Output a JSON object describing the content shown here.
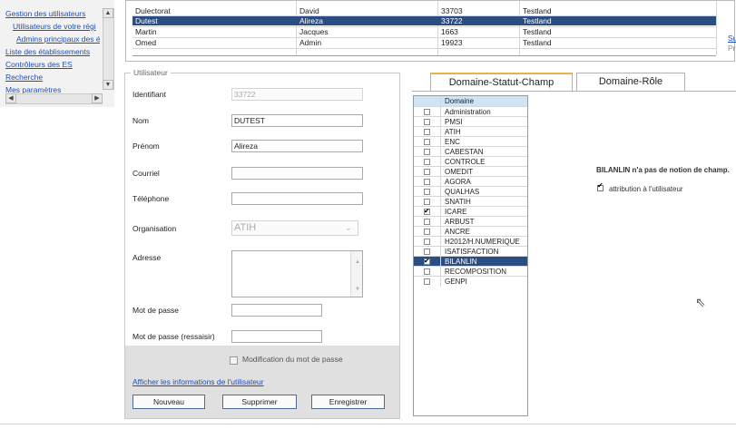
{
  "nav": {
    "items": [
      {
        "label": "Gestion des utilisateurs"
      },
      {
        "label": "Utilisateurs de votre régi"
      },
      {
        "label": "Admins principaux des é"
      },
      {
        "label": "Liste des établissements"
      },
      {
        "label": "Contrôleurs des ES"
      },
      {
        "label": "Recherche"
      },
      {
        "label": "Mes paramètres"
      }
    ]
  },
  "grid": {
    "rows": [
      {
        "nom": "Dulectorat",
        "prenom": "David",
        "id": "33703",
        "org": "Testland",
        "selected": false
      },
      {
        "nom": "Dutest",
        "prenom": "Alireza",
        "id": "33722",
        "org": "Testland",
        "selected": true
      },
      {
        "nom": "Martin",
        "prenom": "Jacques",
        "id": "1663",
        "org": "Testland",
        "selected": false
      },
      {
        "nom": "Omed",
        "prenom": "Admin",
        "id": "19923",
        "org": "Testland",
        "selected": false
      }
    ],
    "pager_next": "Suiva",
    "pager_prev": "Préc"
  },
  "form": {
    "legend": "Utilisateur",
    "identifiant_label": "Identifiant",
    "identifiant_value": "33722",
    "nom_label": "Nom",
    "nom_value": "DUTEST",
    "prenom_label": "Prénom",
    "prenom_value": "Alireza",
    "courriel_label": "Courriel",
    "courriel_value": "",
    "telephone_label": "Téléphone",
    "telephone_value": "",
    "organisation_label": "Organisation",
    "organisation_value": "ATIH",
    "adresse_label": "Adresse",
    "motdepasse_label": "Mot de passe",
    "motdepasse2_label": "Mot de passe (ressaisir)",
    "modif_mdp_label": "Modification du mot de passe",
    "show_info_link": "Afficher les informations de l'utilisateur",
    "btn_nouveau": "Nouveau",
    "btn_supprimer": "Supprimer",
    "btn_enregistrer": "Enregistrer"
  },
  "tabs": [
    {
      "label": "Domaine-Statut-Champ",
      "active": true
    },
    {
      "label": "Domaine-Rôle",
      "active": false
    }
  ],
  "domaine": {
    "header": "Domaine",
    "rows": [
      {
        "label": "Administration",
        "checked": false,
        "selected": false
      },
      {
        "label": "PMSI",
        "checked": false,
        "selected": false
      },
      {
        "label": "ATIH",
        "checked": false,
        "selected": false
      },
      {
        "label": "ENC",
        "checked": false,
        "selected": false
      },
      {
        "label": "CABESTAN",
        "checked": false,
        "selected": false
      },
      {
        "label": "CONTROLE",
        "checked": false,
        "selected": false
      },
      {
        "label": "OMEDIT",
        "checked": false,
        "selected": false
      },
      {
        "label": "AGORA",
        "checked": false,
        "selected": false
      },
      {
        "label": "QUALHAS",
        "checked": false,
        "selected": false
      },
      {
        "label": "SNATIH",
        "checked": false,
        "selected": false
      },
      {
        "label": "ICARE",
        "checked": true,
        "selected": false
      },
      {
        "label": "ARBUST",
        "checked": false,
        "selected": false
      },
      {
        "label": "ANCRE",
        "checked": false,
        "selected": false
      },
      {
        "label": "H2012/H.NUMERIQUE",
        "checked": false,
        "selected": false
      },
      {
        "label": "ISATISFACTION",
        "checked": false,
        "selected": false
      },
      {
        "label": "BILANLIN",
        "checked": true,
        "selected": true
      },
      {
        "label": "RECOMPOSITION",
        "checked": false,
        "selected": false
      },
      {
        "label": "GENPI",
        "checked": false,
        "selected": false
      }
    ]
  },
  "detail": {
    "notice": "BILANLIN n'a pas de notion de champ.",
    "attribution_label": "attribution à l'utilisateur",
    "attribution_checked": true
  },
  "colors": {
    "selection": "#2a4d82",
    "link": "#1a4fbf",
    "table_header": "#cfe3f5",
    "tab_accent": "#e8b24a"
  },
  "icons": {
    "scroll_up": "▲",
    "scroll_down": "▼",
    "scroll_left": "◀",
    "scroll_right": "▶",
    "dropdown": "⌄",
    "check": "✔",
    "cursor": "⇖"
  }
}
